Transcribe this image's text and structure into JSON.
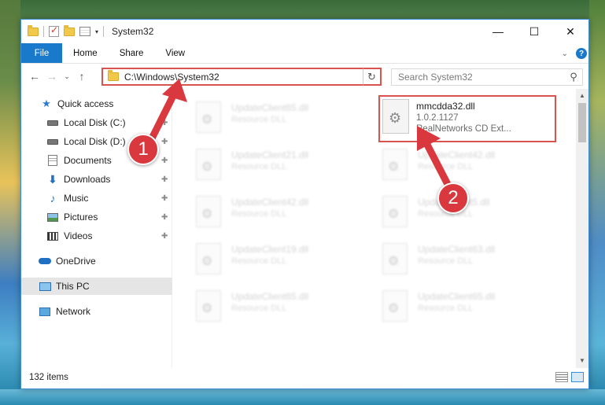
{
  "window": {
    "title": "System32",
    "controls": {
      "minimize": "—",
      "maximize": "☐",
      "close": "✕"
    }
  },
  "ribbon": {
    "tabs": [
      {
        "label": "File"
      },
      {
        "label": "Home"
      },
      {
        "label": "Share"
      },
      {
        "label": "View"
      }
    ],
    "help": "?"
  },
  "navigation": {
    "back": "←",
    "forward": "→",
    "recent": "⌄",
    "up": "↑",
    "address": "C:\\Windows\\System32",
    "search_placeholder": "Search System32"
  },
  "sidebar": {
    "items": [
      {
        "label": "Quick access",
        "icon": "star-icon"
      },
      {
        "label": "Local Disk (C:)",
        "icon": "disk-icon",
        "pinned": true
      },
      {
        "label": "Local Disk (D:)",
        "icon": "disk-icon",
        "pinned": true
      },
      {
        "label": "Documents",
        "icon": "documents-icon",
        "pinned": true
      },
      {
        "label": "Downloads",
        "icon": "download-icon",
        "pinned": true
      },
      {
        "label": "Music",
        "icon": "music-icon",
        "pinned": true
      },
      {
        "label": "Pictures",
        "icon": "pictures-icon",
        "pinned": true
      },
      {
        "label": "Videos",
        "icon": "videos-icon",
        "pinned": true
      },
      {
        "label": "OneDrive",
        "icon": "cloud-icon"
      },
      {
        "label": "This PC",
        "icon": "computer-icon",
        "selected": true
      },
      {
        "label": "Network",
        "icon": "network-icon"
      }
    ]
  },
  "files": {
    "highlighted": {
      "name": "mmcdda32.dll",
      "version": "1.0.2.1127",
      "description": "RealNetworks CD Ext..."
    },
    "left_column": [
      {
        "name": "UpdateClient65.dll",
        "desc": "Resource DLL"
      },
      {
        "name": "UpdateClient21.dll",
        "desc": "Resource DLL"
      },
      {
        "name": "UpdateClient42.dll",
        "desc": "Resource DLL"
      },
      {
        "name": "UpdateClient19.dll",
        "desc": "Resource DLL"
      },
      {
        "name": "UpdateClient65.dll",
        "desc": "Resource DLL"
      }
    ],
    "right_column": [
      {
        "name": "UpdateClient42.dll",
        "desc": "Resource DLL"
      },
      {
        "name": "UpdateClient5.dll",
        "desc": "Resource DLL"
      },
      {
        "name": "UpdateClient63.dll",
        "desc": "Resource DLL"
      },
      {
        "name": "UpdateClient65.dll",
        "desc": "Resource DLL"
      }
    ]
  },
  "status": {
    "item_count": "132 items"
  },
  "annotations": {
    "step1": "1",
    "step2": "2",
    "color": "#d9393e"
  }
}
